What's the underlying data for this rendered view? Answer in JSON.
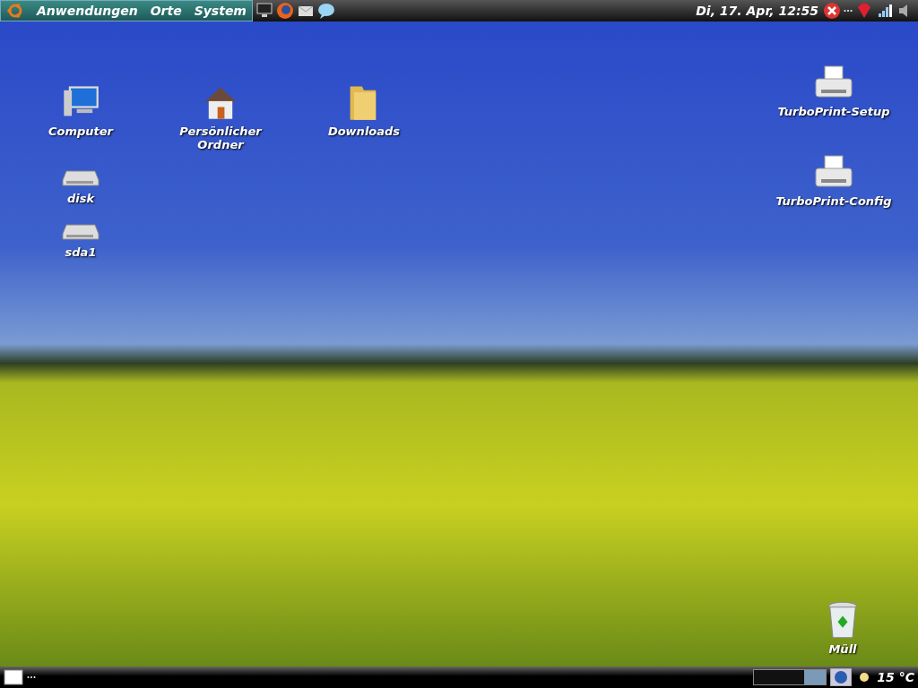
{
  "top_panel": {
    "menus": [
      "Anwendungen",
      "Orte",
      "System"
    ],
    "launchers": [
      {
        "kind": "monitor"
      },
      {
        "kind": "browser"
      },
      {
        "kind": "mail"
      },
      {
        "kind": "chat"
      }
    ],
    "clock": "Di, 17. Apr, 12:55"
  },
  "desktop_icons": [
    {
      "kind": "computer",
      "label": "Computer"
    },
    {
      "kind": "home",
      "label": "Persönlicher Ordner"
    },
    {
      "kind": "folder",
      "label": "Downloads"
    },
    {
      "kind": "drive",
      "label": "disk"
    },
    {
      "kind": "drive",
      "label": "sda1"
    },
    {
      "kind": "printer",
      "label": "TurboPrint-Setup"
    },
    {
      "kind": "printer",
      "label": "TurboPrint-Config"
    },
    {
      "kind": "trash",
      "label": "Müll"
    }
  ],
  "bottom_panel": {
    "weather": "15 °C"
  }
}
